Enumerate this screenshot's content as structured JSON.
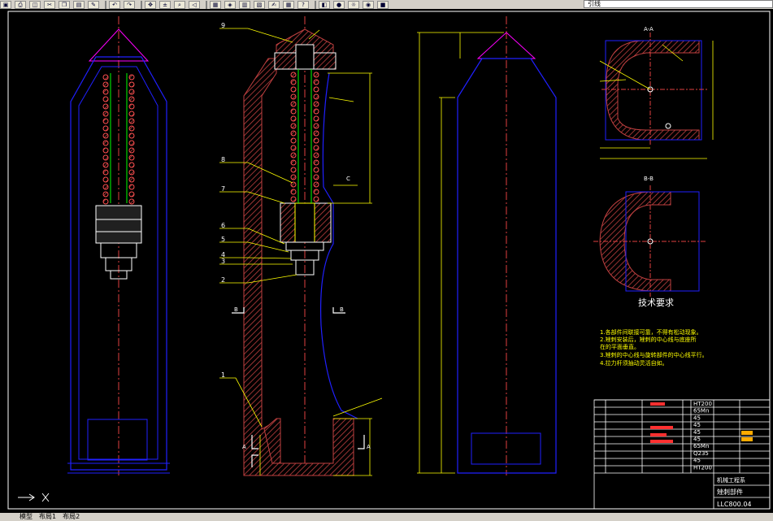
{
  "toolbar": {
    "layer_name": "引线",
    "icons": [
      "save-icon",
      "print-icon",
      "preview-icon",
      "cut-icon",
      "copy-icon",
      "paste-icon",
      "match-icon",
      "undo-icon",
      "redo-icon",
      "pan-icon",
      "zoom-realtime-icon",
      "zoom-window-icon",
      "zoom-previous-icon",
      "properties-icon",
      "design-center-icon",
      "tool-palette-icon",
      "sheet-set-icon",
      "markup-icon",
      "calculator-icon",
      "help-icon",
      "layer-manager-icon",
      "bulb-icon",
      "sun-icon",
      "lock-icon",
      "color-icon"
    ]
  },
  "drawing": {
    "part_labels": [
      "9",
      "8",
      "7",
      "6",
      "5",
      "4",
      "3",
      "2",
      "1"
    ],
    "section_aa": "A-A",
    "section_bb": "B-B",
    "section_marks": [
      "A",
      "A",
      "B",
      "B",
      "C"
    ],
    "tech_title": "技术要求",
    "tech_notes": [
      "1.各部件间联接可靠，不得有松动现象。",
      "2.矬刺安装后，矬刺的中心线与底座所",
      "   在的平面垂直。",
      "3.矬刺的中心线与旋转部件的中心线平行。",
      "4.拉力杆须抽动灵活自如。"
    ],
    "materials": [
      "HT200",
      "65Mn",
      "45",
      "45",
      "45",
      "45",
      "65Mn",
      "Q235",
      "45",
      "HT200"
    ],
    "title_block": {
      "company": "机械工程系",
      "name": "矬刺部件",
      "drawing_no": "LLC800.04"
    }
  },
  "status": {
    "tabs": [
      "模型",
      "布局1",
      "布局2"
    ]
  }
}
